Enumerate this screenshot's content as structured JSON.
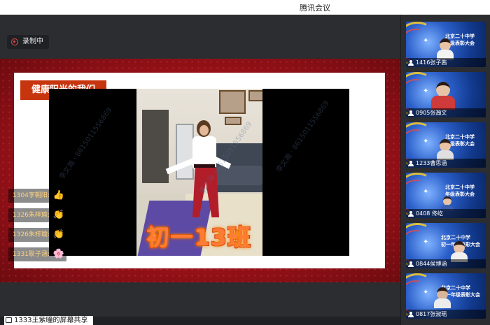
{
  "window": {
    "title": "腾讯会议"
  },
  "recording": {
    "label": "录制中",
    "icon": "record-icon"
  },
  "slide": {
    "banner": "健康阳光的我们",
    "caption": "初一13班",
    "watermark_text": "李文瀚 · 8615011556869"
  },
  "reactions": [
    {
      "name": "1304李朝阳:",
      "emoji": "👍"
    },
    {
      "name": "1326朱梓瑜:",
      "emoji": "👏"
    },
    {
      "name": "1326朱梓瑜:",
      "emoji": "👏"
    },
    {
      "name": "1331耿子涵:",
      "emoji": "🌸"
    }
  ],
  "share": {
    "label": "1333王紫曈的屏幕共享",
    "icon": "screen-share-icon"
  },
  "participants": [
    {
      "name": "1416张子茜",
      "school_line1": "北京二十中学",
      "school_line2": "年级表彰大会"
    },
    {
      "name": "0905张瀚文",
      "school_line1": "",
      "school_line2": ""
    },
    {
      "name": "1233曹思涵",
      "school_line1": "北京二十中学",
      "school_line2": "年级表彰大会"
    },
    {
      "name": "0408 佟屹",
      "school_line1": "北京二十中学",
      "school_line2": "年级表彰大会"
    },
    {
      "name": "0844侯博涵",
      "school_line1": "北京二十中学",
      "school_line2": "初一年级表彰大会"
    },
    {
      "name": "0817张淑瑶",
      "school_line1": "北京二十中学",
      "school_line2": "初一年级表彰大会"
    }
  ],
  "colors": {
    "banner": "#c7350f",
    "stage_red": "#a8141b",
    "caption": "#ff7a3a"
  }
}
